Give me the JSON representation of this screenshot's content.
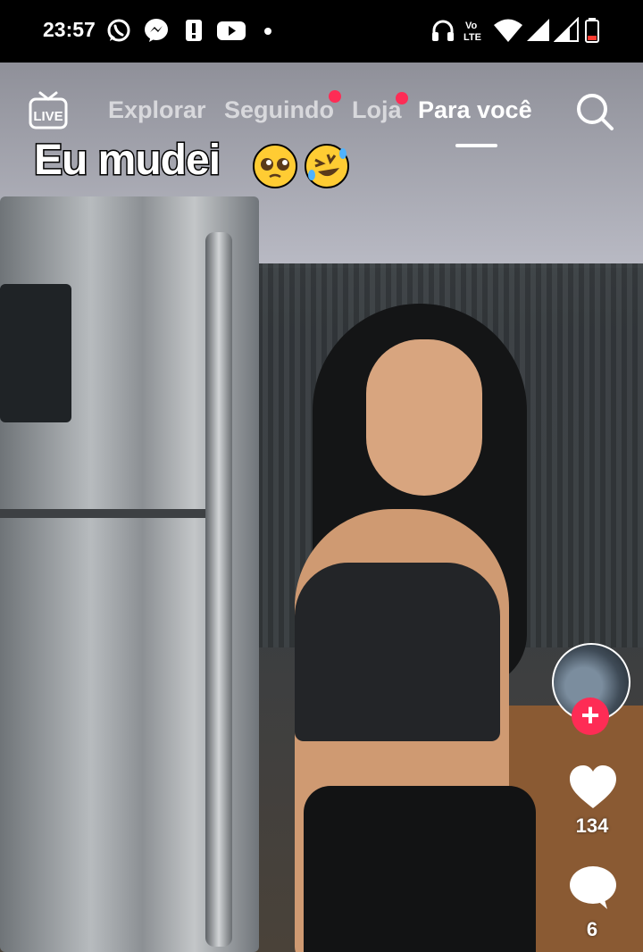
{
  "status_bar": {
    "time": "23:57",
    "left_icons": [
      "whatsapp-icon",
      "messenger-icon",
      "alert-icon",
      "youtube-icon",
      "dot-icon"
    ],
    "right_icons": [
      "headphones-icon",
      "volte-icon",
      "wifi-icon",
      "signal-icon",
      "signal-icon",
      "battery-low-icon"
    ],
    "volte_label": "Vo LTE",
    "battery_color": "#ff3b30"
  },
  "top_nav": {
    "live_label": "LIVE",
    "tabs": [
      {
        "label": "Explorar",
        "active": false,
        "notification_dot": false
      },
      {
        "label": "Seguindo",
        "active": false,
        "notification_dot": true
      },
      {
        "label": "Loja",
        "active": false,
        "notification_dot": true
      },
      {
        "label": "Para você",
        "active": true,
        "notification_dot": false
      }
    ],
    "search_icon": "search-icon",
    "accent_color": "#fe2c55"
  },
  "video": {
    "caption_text": "Eu mudei",
    "caption_emojis": [
      "pleading-face-emoji",
      "rofl-emoji"
    ]
  },
  "side_actions": {
    "follow_label": "+",
    "like_count": "134",
    "comment_count": "6"
  }
}
